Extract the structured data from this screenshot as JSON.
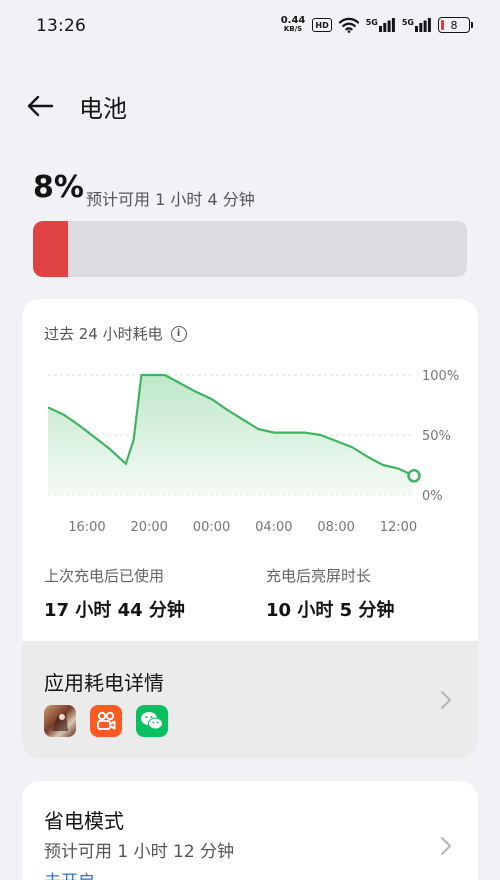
{
  "status_bar": {
    "time": "13:26",
    "net_speed_value": "0.44",
    "net_speed_unit": "KB/S",
    "hd_label": "HD",
    "sim1_tag": "5G",
    "sim2_tag": "5G",
    "battery_level": "8"
  },
  "header": {
    "back_icon": "back-arrow-icon",
    "title": "电池"
  },
  "battery": {
    "percent_text": "8%",
    "percent_value": 8,
    "estimate": "预计可用 1 小时 4 分钟",
    "bar_color": "#e04343"
  },
  "usage_card": {
    "title": "过去 24 小时耗电",
    "info_icon": "info-icon",
    "chart_data": {
      "type": "area",
      "x_ticks": [
        "16:00",
        "20:00",
        "00:00",
        "04:00",
        "08:00",
        "12:00"
      ],
      "y_ticks": [
        "100%",
        "50%",
        "0%"
      ],
      "ylim": [
        0,
        100
      ],
      "series": [
        {
          "points": [
            [
              "13:30",
              73
            ],
            [
              "14:30",
              67
            ],
            [
              "15:30",
              58
            ],
            [
              "16:30",
              48
            ],
            [
              "17:30",
              38
            ],
            [
              "18:30",
              26
            ],
            [
              "19:00",
              46
            ],
            [
              "19:30",
              100
            ],
            [
              "21:00",
              100
            ],
            [
              "22:00",
              93
            ],
            [
              "23:00",
              86
            ],
            [
              "00:00",
              80
            ],
            [
              "01:00",
              71
            ],
            [
              "02:00",
              63
            ],
            [
              "03:00",
              55
            ],
            [
              "04:00",
              52
            ],
            [
              "05:00",
              52
            ],
            [
              "06:00",
              52
            ],
            [
              "07:00",
              50
            ],
            [
              "08:00",
              45
            ],
            [
              "09:00",
              40
            ],
            [
              "10:00",
              32
            ],
            [
              "11:00",
              25
            ],
            [
              "12:00",
              22
            ],
            [
              "13:00",
              16
            ]
          ]
        }
      ],
      "line_color": "#3fb45f",
      "fill_color": "#d9f1df",
      "grid": true
    },
    "stat_left": {
      "label": "上次充电后已使用",
      "value": "17 小时 44 分钟"
    },
    "stat_right": {
      "label": "充电后亮屏时长",
      "value": "10 小时 5 分钟"
    },
    "detail": {
      "title": "应用耗电详情",
      "apps": [
        "game-app-icon",
        "video-app-icon",
        "wechat-icon"
      ],
      "chevron_icon": "chevron-right-icon"
    }
  },
  "saver_card": {
    "title": "省电模式",
    "subtitle": "预计可用 1 小时 12 分钟",
    "status": "未开启",
    "chevron_icon": "chevron-right-icon"
  }
}
